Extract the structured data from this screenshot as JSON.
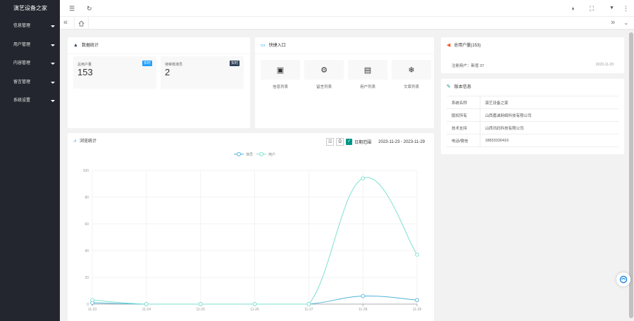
{
  "app": {
    "title": "演艺设备之家"
  },
  "sidebar": {
    "items": [
      {
        "label": "信息管理"
      },
      {
        "label": "用户管理"
      },
      {
        "label": "内容管理"
      },
      {
        "label": "留言管理"
      },
      {
        "label": "系统设置"
      }
    ]
  },
  "stats": {
    "title": "数据统计",
    "items": [
      {
        "label": "总用户量",
        "value": "153",
        "badge": "实时",
        "badge_color": "#1e9fff"
      },
      {
        "label": "待审核演员",
        "value": "2",
        "badge": "实时",
        "badge_color": "#2f4056"
      }
    ]
  },
  "quick": {
    "title": "快捷入口",
    "items": [
      {
        "label": "信息列表",
        "icon": "window-icon"
      },
      {
        "label": "留言列表",
        "icon": "gears-icon"
      },
      {
        "label": "用户列表",
        "icon": "file-icon"
      },
      {
        "label": "文章列表",
        "icon": "snowflake-icon"
      }
    ]
  },
  "user_total": {
    "title": "总用户量(153)",
    "row_label": "注册用户：新增 37",
    "date": "2023-11-29"
  },
  "version": {
    "title": "版本信息",
    "rows": [
      {
        "key": "系统名称",
        "value": "演艺设备之家"
      },
      {
        "key": "版权所有",
        "value": "山西嘉诚网络科技有限公司"
      },
      {
        "key": "技术支持",
        "value": "山西讯码科技有限公司"
      },
      {
        "key": "电话/微信",
        "value": "18833330416"
      }
    ]
  },
  "traffic": {
    "title": "浏览统计",
    "checkbox_label": "日期范围",
    "date_range": "2023-11-23 - 2023-11-29"
  },
  "chart_data": {
    "type": "line",
    "x": [
      "11-23",
      "11-24",
      "11-25",
      "11-26",
      "11-27",
      "11-28",
      "11-29"
    ],
    "ylim": [
      0,
      100
    ],
    "yticks": [
      0,
      20,
      40,
      60,
      80,
      100
    ],
    "series": [
      {
        "name": "演员",
        "color": "#4fb3d9",
        "values": [
          1,
          0,
          0,
          0,
          0,
          6,
          3
        ]
      },
      {
        "name": "用户",
        "color": "#7ee0cf",
        "values": [
          3,
          0,
          0,
          0,
          0,
          94,
          37
        ]
      }
    ]
  }
}
